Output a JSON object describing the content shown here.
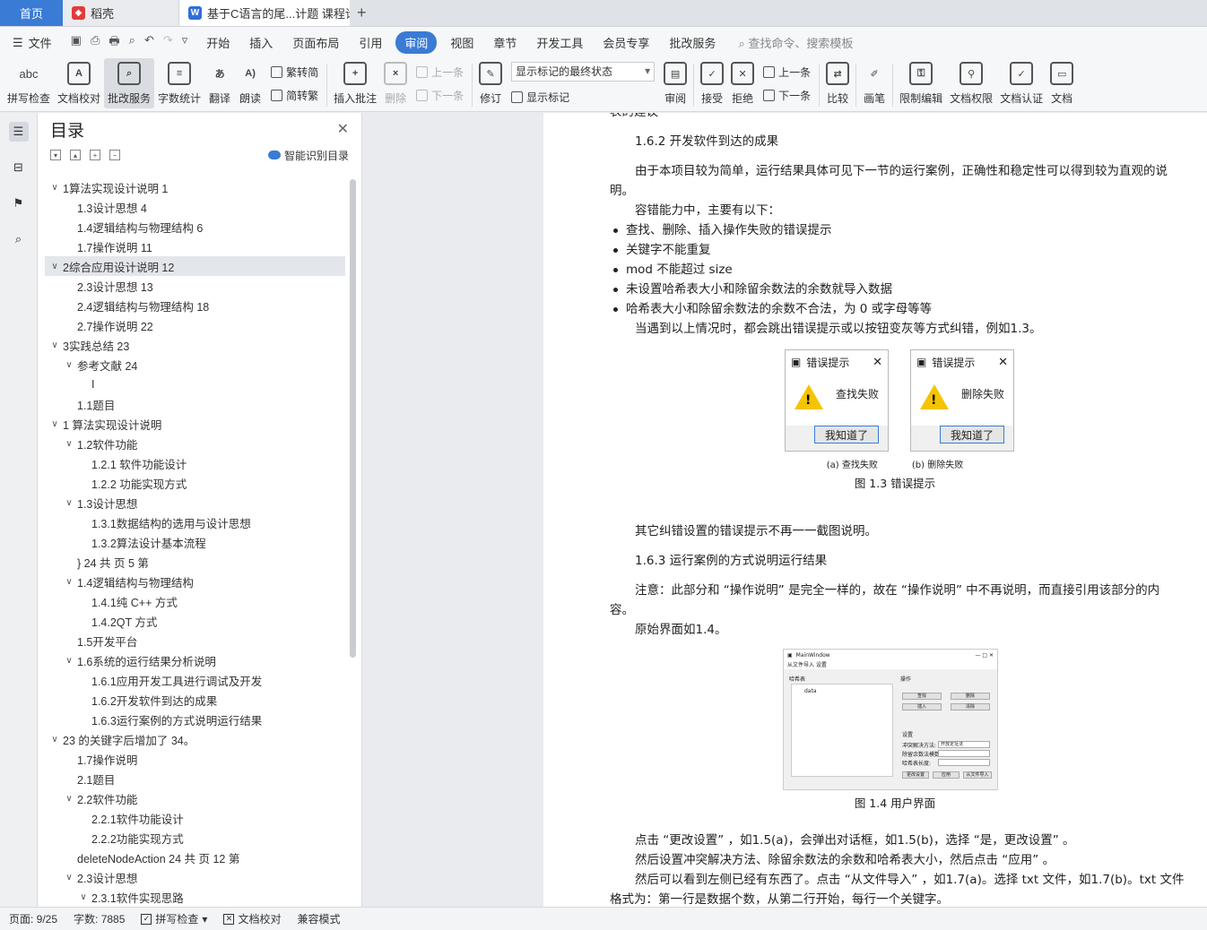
{
  "tabs": {
    "home": "首页",
    "daoke": "稻壳",
    "doc": "基于C语言的尾...计题 课程论文",
    "add": "+"
  },
  "menubar": {
    "file": "文件",
    "items": [
      "开始",
      "插入",
      "页面布局",
      "引用",
      "审阅",
      "视图",
      "章节",
      "开发工具",
      "会员专享",
      "批改服务"
    ],
    "active": "审阅",
    "search": "查找命令、搜索模板"
  },
  "ribbon": {
    "spell": "拼写检查",
    "spell_icon_text": "abc",
    "proof": "文档校对",
    "review_service": "批改服务",
    "wordcount": "字数统计",
    "translate": "翻译",
    "read": "朗读",
    "trad": "繁转简",
    "simp": "简转繁",
    "insert_comment": "插入批注",
    "delete": "删除",
    "prev_c": "上一条",
    "next_c": "下一条",
    "revise": "修订",
    "markup_select": "显示标记的最终状态",
    "show_markup": "显示标记",
    "review": "审阅",
    "accept": "接受",
    "reject": "拒绝",
    "prev": "上一条",
    "next": "下一条",
    "compare": "比较",
    "pen": "画笔",
    "restrict": "限制编辑",
    "permission": "文档权限",
    "certify": "文档认证",
    "more": "文档"
  },
  "toc": {
    "title": "目录",
    "smart": "智能识别目录",
    "items": [
      {
        "t": "1算法实现设计说明  1",
        "l": 0,
        "c": "v"
      },
      {
        "t": "1.3设计思想  4",
        "l": 1,
        "c": ""
      },
      {
        "t": "1.4逻辑结构与物理结构  6",
        "l": 1,
        "c": ""
      },
      {
        "t": "1.7操作说明  11",
        "l": 1,
        "c": ""
      },
      {
        "t": "2综合应用设计说明  12",
        "l": 0,
        "c": "v",
        "sel": true
      },
      {
        "t": "2.3设计思想  13",
        "l": 1,
        "c": ""
      },
      {
        "t": "2.4逻辑结构与物理结构  18",
        "l": 1,
        "c": ""
      },
      {
        "t": "2.7操作说明  22",
        "l": 1,
        "c": ""
      },
      {
        "t": "3实践总结  23",
        "l": 0,
        "c": "v"
      },
      {
        "t": "参考文献  24",
        "l": 1,
        "c": "v"
      },
      {
        "t": "I",
        "l": 2,
        "c": ""
      },
      {
        "t": "1.1题目",
        "l": 1,
        "c": ""
      },
      {
        "t": "1 算法实现设计说明",
        "l": 0,
        "c": "v"
      },
      {
        "t": "1.2软件功能",
        "l": 1,
        "c": "v"
      },
      {
        "t": "1.2.1 软件功能设计",
        "l": 2,
        "c": ""
      },
      {
        "t": "1.2.2 功能实现方式",
        "l": 2,
        "c": ""
      },
      {
        "t": "1.3设计思想",
        "l": 1,
        "c": "v"
      },
      {
        "t": "1.3.1数据结构的选用与设计思想",
        "l": 2,
        "c": ""
      },
      {
        "t": "1.3.2算法设计基本流程",
        "l": 2,
        "c": ""
      },
      {
        "t": "}  24  共  页 5 第",
        "l": 1,
        "c": ""
      },
      {
        "t": "1.4逻辑结构与物理结构",
        "l": 1,
        "c": "v"
      },
      {
        "t": "1.4.1纯 C++ 方式",
        "l": 2,
        "c": ""
      },
      {
        "t": "1.4.2QT 方式",
        "l": 2,
        "c": ""
      },
      {
        "t": "1.5开发平台",
        "l": 1,
        "c": ""
      },
      {
        "t": "1.6系统的运行结果分析说明",
        "l": 1,
        "c": "v"
      },
      {
        "t": "1.6.1应用开发工具进行调试及开发",
        "l": 2,
        "c": ""
      },
      {
        "t": "1.6.2开发软件到达的成果",
        "l": 2,
        "c": ""
      },
      {
        "t": "1.6.3运行案例的方式说明运行结果",
        "l": 2,
        "c": ""
      },
      {
        "t": "23 的关键字后增加了 34。",
        "l": 0,
        "c": "v"
      },
      {
        "t": "1.7操作说明",
        "l": 1,
        "c": ""
      },
      {
        "t": "2.1题目",
        "l": 1,
        "c": ""
      },
      {
        "t": "2.2软件功能",
        "l": 1,
        "c": "v"
      },
      {
        "t": "2.2.1软件功能设计",
        "l": 2,
        "c": ""
      },
      {
        "t": "2.2.2功能实现方式",
        "l": 2,
        "c": ""
      },
      {
        "t": "deleteNodeAction  24  共  页 12 第",
        "l": 1,
        "c": ""
      },
      {
        "t": "2.3设计思想",
        "l": 1,
        "c": "v"
      },
      {
        "t": "2.3.1软件实现思路",
        "l": 2,
        "c": "v"
      }
    ]
  },
  "doc": {
    "top_cut": "表的建议",
    "h162": "1.6.2 开发软件到达的成果",
    "p1": "由于本项目较为简单，运行结果具体可见下一节的运行案例，正确性和稳定性可以得到较为直观的说",
    "p1b": "明。",
    "p2": "容错能力中，主要有以下：",
    "bullets": [
      "查找、删除、插入操作失败的错误提示",
      "关键字不能重复",
      "mod 不能超过  size",
      "未设置哈希表大小和除留余数法的余数就导入数据",
      "哈希表大小和除留余数法的余数不合法，为  0 或字母等等"
    ],
    "p3": "当遇到以上情况时，都会跳出错误提示或以按钮变灰等方式纠错，例如1.3。",
    "dlg1": {
      "title": "错误提示",
      "msg": "查找失败",
      "btn": "我知道了",
      "sub": "(a)  查找失败"
    },
    "dlg2": {
      "title": "错误提示",
      "msg": "删除失败",
      "btn": "我知道了",
      "sub": "(b)  删除失败"
    },
    "cap13": "图  1.3 错误提示",
    "p4": "其它纠错设置的错误提示不再一一截图说明。",
    "h163": "1.6.3 运行案例的方式说明运行结果",
    "p5": "注意：此部分和 “操作说明” 是完全一样的，故在 “操作说明” 中不再说明，而直接引用该部分的内",
    "p5b": "容。",
    "p6": "原始界面如1.4。",
    "mw": {
      "title": "MainWindow",
      "menu": "从文件导入  设置",
      "left_label": "哈希表",
      "list_item": "data",
      "ops": "操作",
      "find": "查找",
      "del": "删除",
      "ins": "插入",
      "clear": "清除",
      "settings": "设置",
      "l1": "冲突解决方法:",
      "l1v": "开放定址法",
      "l2": "除留余数法模数:",
      "l3": "哈希表长度:",
      "b1": "更改设置",
      "b2": "应用",
      "b3": "从文件导入"
    },
    "cap14": "图  1.4 用户界面",
    "p7": "点击 “更改设置” ，如1.5(a)，会弹出对话框，如1.5(b)，选择 “是，更改设置” 。",
    "p8": "然后设置冲突解决方法、除留余数法的余数和哈希表大小，然后点击 “应用” 。",
    "p9": "然后可以看到左侧已经有东西了。点击 “从文件导入” ，如1.7(a)。选择  txt 文件，如1.7(b)。txt 文件",
    "p10": "格式为：第一行是数据个数，从第二行开始，每行一个关键字。"
  },
  "status": {
    "page": "页面: 9/25",
    "words": "字数: 7885",
    "spell": "拼写检查",
    "proof": "文档校对",
    "compat": "兼容模式"
  }
}
